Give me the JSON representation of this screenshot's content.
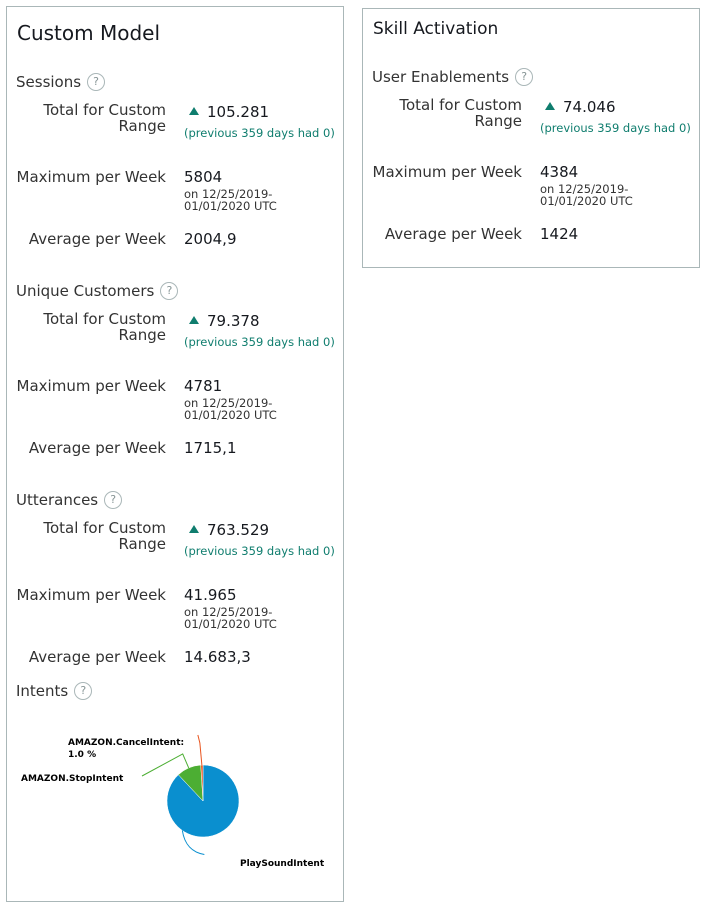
{
  "custom_model": {
    "title": "Custom Model",
    "help_glyph": "?",
    "sessions": {
      "title": "Sessions",
      "total_label": "Total for Custom Range",
      "total_value": "105.281",
      "total_note": "(previous 359 days had 0)",
      "max_label": "Maximum per Week",
      "max_value": "5804",
      "max_date_line1": "on 12/25/2019-",
      "max_date_line2": "01/01/2020 UTC",
      "avg_label": "Average per Week",
      "avg_value": "2004,9"
    },
    "unique_customers": {
      "title": "Unique Customers",
      "total_label": "Total for Custom Range",
      "total_value": "79.378",
      "total_note": "(previous 359 days had 0)",
      "max_label": "Maximum per Week",
      "max_value": "4781",
      "max_date_line1": "on 12/25/2019-",
      "max_date_line2": "01/01/2020 UTC",
      "avg_label": "Average per Week",
      "avg_value": "1715,1"
    },
    "utterances": {
      "title": "Utterances",
      "total_label": "Total for Custom Range",
      "total_value": "763.529",
      "total_note": "(previous 359 days had 0)",
      "max_label": "Maximum per Week",
      "max_value": "41.965",
      "max_date_line1": "on 12/25/2019-",
      "max_date_line2": "01/01/2020 UTC",
      "avg_label": "Average per Week",
      "avg_value": "14.683,3"
    },
    "intents": {
      "title": "Intents"
    }
  },
  "skill_activation": {
    "title": "Skill Activation",
    "help_glyph": "?",
    "user_enablements": {
      "title": "User Enablements",
      "total_label": "Total for Custom Range",
      "total_value": "74.046",
      "total_note": "(previous 359 days had 0)",
      "max_label": "Maximum per Week",
      "max_value": "4384",
      "max_date_line1": "on 12/25/2019-",
      "max_date_line2": "01/01/2020 UTC",
      "avg_label": "Average per Week",
      "avg_value": "1424"
    }
  },
  "colors": {
    "trend_up": "#0f7d6e",
    "note_text": "#0f7d6e",
    "border": "#aab7b8"
  },
  "chart_data": {
    "type": "pie",
    "title": "",
    "slices": [
      {
        "name": "PlaySoundIntent",
        "value": 88.0,
        "color": "#0a8fcf",
        "label": "PlaySoundIntent"
      },
      {
        "name": "AMAZON.StopIntent",
        "value": 11.0,
        "color": "#4cae33",
        "label": "AMAZON.StopIntent"
      },
      {
        "name": "AMAZON.CancelIntent",
        "value": 1.0,
        "color": "#e8541e",
        "label_line1": "AMAZON.CancelIntent:",
        "label_line2": "1.0 %"
      }
    ]
  }
}
